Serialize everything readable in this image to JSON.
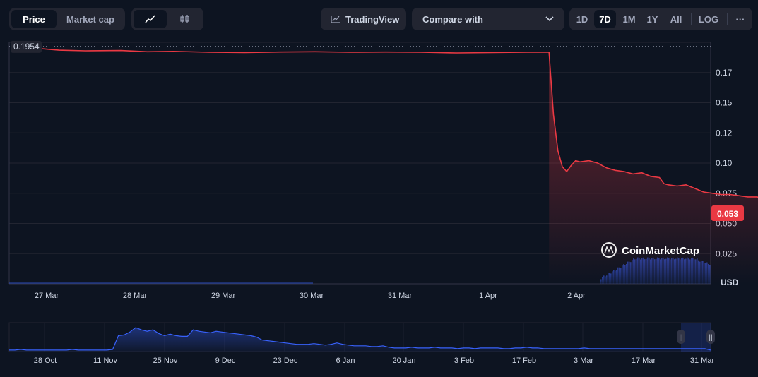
{
  "toolbar": {
    "price_tab": "Price",
    "market_cap_tab": "Market cap",
    "line_chart_icon": "line-chart-icon",
    "candle_chart_icon": "candlestick-icon",
    "tradingview_label": "TradingView",
    "compare_label": "Compare with",
    "ranges": [
      "1D",
      "7D",
      "1M",
      "1Y",
      "All"
    ],
    "active_range": "7D",
    "log_label": "LOG",
    "more_label": "···"
  },
  "colors": {
    "background": "#0d1421",
    "price_line": "#ea3943",
    "volume": "#3861fb",
    "badge": "#ea3943"
  },
  "chart_data": [
    {
      "type": "line",
      "title": "",
      "ylabel": "USD",
      "y_ticks": [
        "0.025",
        "0.050",
        "0.075",
        "0.10",
        "0.12",
        "0.15",
        "0.17"
      ],
      "x_ticks": [
        "27 Mar",
        "28 Mar",
        "29 Mar",
        "30 Mar",
        "31 Mar",
        "1 Apr",
        "2 Apr"
      ],
      "ylim": [
        0,
        0.2
      ],
      "grid": true,
      "open_label": "0.1954",
      "current_label": "0.053",
      "x": [
        0,
        0.3,
        0.6,
        1,
        1.3,
        1.6,
        2,
        2.4,
        2.8,
        3.2,
        3.6,
        4,
        4.4,
        4.8,
        5.2,
        5.6,
        5.85,
        5.9,
        5.95,
        6.0,
        6.05,
        6.1,
        6.15,
        6.2,
        6.3,
        6.4,
        6.5,
        6.6,
        6.7,
        6.8,
        6.9,
        7.0,
        7.1,
        7.15,
        7.2,
        7.3,
        7.4,
        7.5,
        7.6,
        7.7,
        7.8,
        7.9,
        8.0,
        8.1,
        8.2,
        8.3,
        8.4,
        8.5,
        8.6,
        8.65
      ],
      "y": [
        0.1954,
        0.1935,
        0.193,
        0.1932,
        0.1922,
        0.1925,
        0.1918,
        0.1915,
        0.192,
        0.1922,
        0.1918,
        0.192,
        0.1918,
        0.1912,
        0.1915,
        0.1918,
        0.1918,
        0.14,
        0.11,
        0.097,
        0.093,
        0.098,
        0.102,
        0.101,
        0.102,
        0.1,
        0.096,
        0.094,
        0.093,
        0.091,
        0.092,
        0.089,
        0.088,
        0.083,
        0.082,
        0.081,
        0.082,
        0.079,
        0.076,
        0.075,
        0.074,
        0.074,
        0.073,
        0.072,
        0.072,
        0.071,
        0.07,
        0.069,
        0.06,
        0.055
      ]
    },
    {
      "type": "area",
      "title": "navigator",
      "x_ticks": [
        "28 Oct",
        "11 Nov",
        "25 Nov",
        "9 Dec",
        "23 Dec",
        "6 Jan",
        "20 Jan",
        "3 Feb",
        "17 Feb",
        "3 Mar",
        "17 Mar",
        "31 Mar"
      ],
      "values": [
        2,
        2,
        3,
        2,
        2,
        2,
        2,
        2,
        2,
        2,
        2,
        3,
        2,
        2,
        2,
        2,
        2,
        2,
        3,
        22,
        23,
        27,
        33,
        30,
        28,
        30,
        25,
        22,
        24,
        22,
        21,
        21,
        30,
        28,
        27,
        26,
        28,
        27,
        26,
        25,
        24,
        23,
        22,
        20,
        16,
        15,
        14,
        13,
        12,
        11,
        10,
        10,
        10,
        11,
        10,
        9,
        10,
        12,
        10,
        9,
        8,
        8,
        8,
        7,
        7,
        8,
        6,
        5,
        5,
        5,
        6,
        5,
        5,
        5,
        6,
        5,
        5,
        5,
        4,
        5,
        5,
        4,
        5,
        5,
        5,
        5,
        4,
        4,
        5,
        5,
        6,
        5,
        5,
        4,
        4,
        4,
        4,
        4,
        4,
        4,
        5,
        4,
        4,
        4,
        4,
        4,
        4,
        4,
        4,
        4,
        4,
        4,
        4,
        4,
        4,
        4,
        4,
        4,
        4,
        4,
        4,
        4,
        2
      ],
      "ylim": [
        0,
        36
      ]
    }
  ],
  "watermark": "CoinMarketCap",
  "currency_label": "USD",
  "navigator_handles": [
    "||",
    "||"
  ]
}
